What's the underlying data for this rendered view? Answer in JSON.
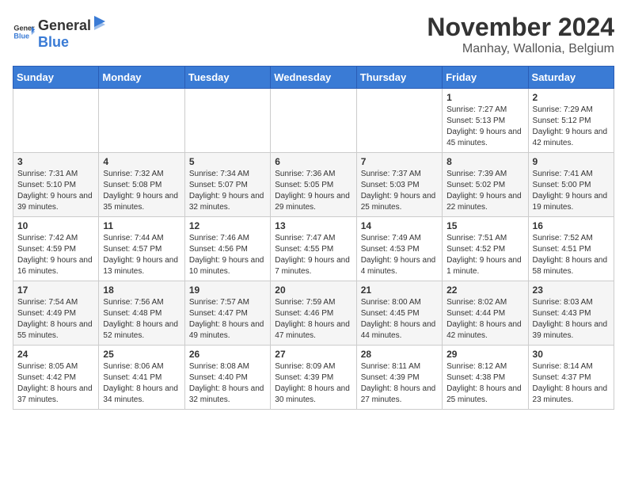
{
  "logo": {
    "general": "General",
    "blue": "Blue"
  },
  "title": "November 2024",
  "location": "Manhay, Wallonia, Belgium",
  "days_of_week": [
    "Sunday",
    "Monday",
    "Tuesday",
    "Wednesday",
    "Thursday",
    "Friday",
    "Saturday"
  ],
  "weeks": [
    [
      {
        "day": "",
        "info": ""
      },
      {
        "day": "",
        "info": ""
      },
      {
        "day": "",
        "info": ""
      },
      {
        "day": "",
        "info": ""
      },
      {
        "day": "",
        "info": ""
      },
      {
        "day": "1",
        "info": "Sunrise: 7:27 AM\nSunset: 5:13 PM\nDaylight: 9 hours and 45 minutes."
      },
      {
        "day": "2",
        "info": "Sunrise: 7:29 AM\nSunset: 5:12 PM\nDaylight: 9 hours and 42 minutes."
      }
    ],
    [
      {
        "day": "3",
        "info": "Sunrise: 7:31 AM\nSunset: 5:10 PM\nDaylight: 9 hours and 39 minutes."
      },
      {
        "day": "4",
        "info": "Sunrise: 7:32 AM\nSunset: 5:08 PM\nDaylight: 9 hours and 35 minutes."
      },
      {
        "day": "5",
        "info": "Sunrise: 7:34 AM\nSunset: 5:07 PM\nDaylight: 9 hours and 32 minutes."
      },
      {
        "day": "6",
        "info": "Sunrise: 7:36 AM\nSunset: 5:05 PM\nDaylight: 9 hours and 29 minutes."
      },
      {
        "day": "7",
        "info": "Sunrise: 7:37 AM\nSunset: 5:03 PM\nDaylight: 9 hours and 25 minutes."
      },
      {
        "day": "8",
        "info": "Sunrise: 7:39 AM\nSunset: 5:02 PM\nDaylight: 9 hours and 22 minutes."
      },
      {
        "day": "9",
        "info": "Sunrise: 7:41 AM\nSunset: 5:00 PM\nDaylight: 9 hours and 19 minutes."
      }
    ],
    [
      {
        "day": "10",
        "info": "Sunrise: 7:42 AM\nSunset: 4:59 PM\nDaylight: 9 hours and 16 minutes."
      },
      {
        "day": "11",
        "info": "Sunrise: 7:44 AM\nSunset: 4:57 PM\nDaylight: 9 hours and 13 minutes."
      },
      {
        "day": "12",
        "info": "Sunrise: 7:46 AM\nSunset: 4:56 PM\nDaylight: 9 hours and 10 minutes."
      },
      {
        "day": "13",
        "info": "Sunrise: 7:47 AM\nSunset: 4:55 PM\nDaylight: 9 hours and 7 minutes."
      },
      {
        "day": "14",
        "info": "Sunrise: 7:49 AM\nSunset: 4:53 PM\nDaylight: 9 hours and 4 minutes."
      },
      {
        "day": "15",
        "info": "Sunrise: 7:51 AM\nSunset: 4:52 PM\nDaylight: 9 hours and 1 minute."
      },
      {
        "day": "16",
        "info": "Sunrise: 7:52 AM\nSunset: 4:51 PM\nDaylight: 8 hours and 58 minutes."
      }
    ],
    [
      {
        "day": "17",
        "info": "Sunrise: 7:54 AM\nSunset: 4:49 PM\nDaylight: 8 hours and 55 minutes."
      },
      {
        "day": "18",
        "info": "Sunrise: 7:56 AM\nSunset: 4:48 PM\nDaylight: 8 hours and 52 minutes."
      },
      {
        "day": "19",
        "info": "Sunrise: 7:57 AM\nSunset: 4:47 PM\nDaylight: 8 hours and 49 minutes."
      },
      {
        "day": "20",
        "info": "Sunrise: 7:59 AM\nSunset: 4:46 PM\nDaylight: 8 hours and 47 minutes."
      },
      {
        "day": "21",
        "info": "Sunrise: 8:00 AM\nSunset: 4:45 PM\nDaylight: 8 hours and 44 minutes."
      },
      {
        "day": "22",
        "info": "Sunrise: 8:02 AM\nSunset: 4:44 PM\nDaylight: 8 hours and 42 minutes."
      },
      {
        "day": "23",
        "info": "Sunrise: 8:03 AM\nSunset: 4:43 PM\nDaylight: 8 hours and 39 minutes."
      }
    ],
    [
      {
        "day": "24",
        "info": "Sunrise: 8:05 AM\nSunset: 4:42 PM\nDaylight: 8 hours and 37 minutes."
      },
      {
        "day": "25",
        "info": "Sunrise: 8:06 AM\nSunset: 4:41 PM\nDaylight: 8 hours and 34 minutes."
      },
      {
        "day": "26",
        "info": "Sunrise: 8:08 AM\nSunset: 4:40 PM\nDaylight: 8 hours and 32 minutes."
      },
      {
        "day": "27",
        "info": "Sunrise: 8:09 AM\nSunset: 4:39 PM\nDaylight: 8 hours and 30 minutes."
      },
      {
        "day": "28",
        "info": "Sunrise: 8:11 AM\nSunset: 4:39 PM\nDaylight: 8 hours and 27 minutes."
      },
      {
        "day": "29",
        "info": "Sunrise: 8:12 AM\nSunset: 4:38 PM\nDaylight: 8 hours and 25 minutes."
      },
      {
        "day": "30",
        "info": "Sunrise: 8:14 AM\nSunset: 4:37 PM\nDaylight: 8 hours and 23 minutes."
      }
    ]
  ]
}
